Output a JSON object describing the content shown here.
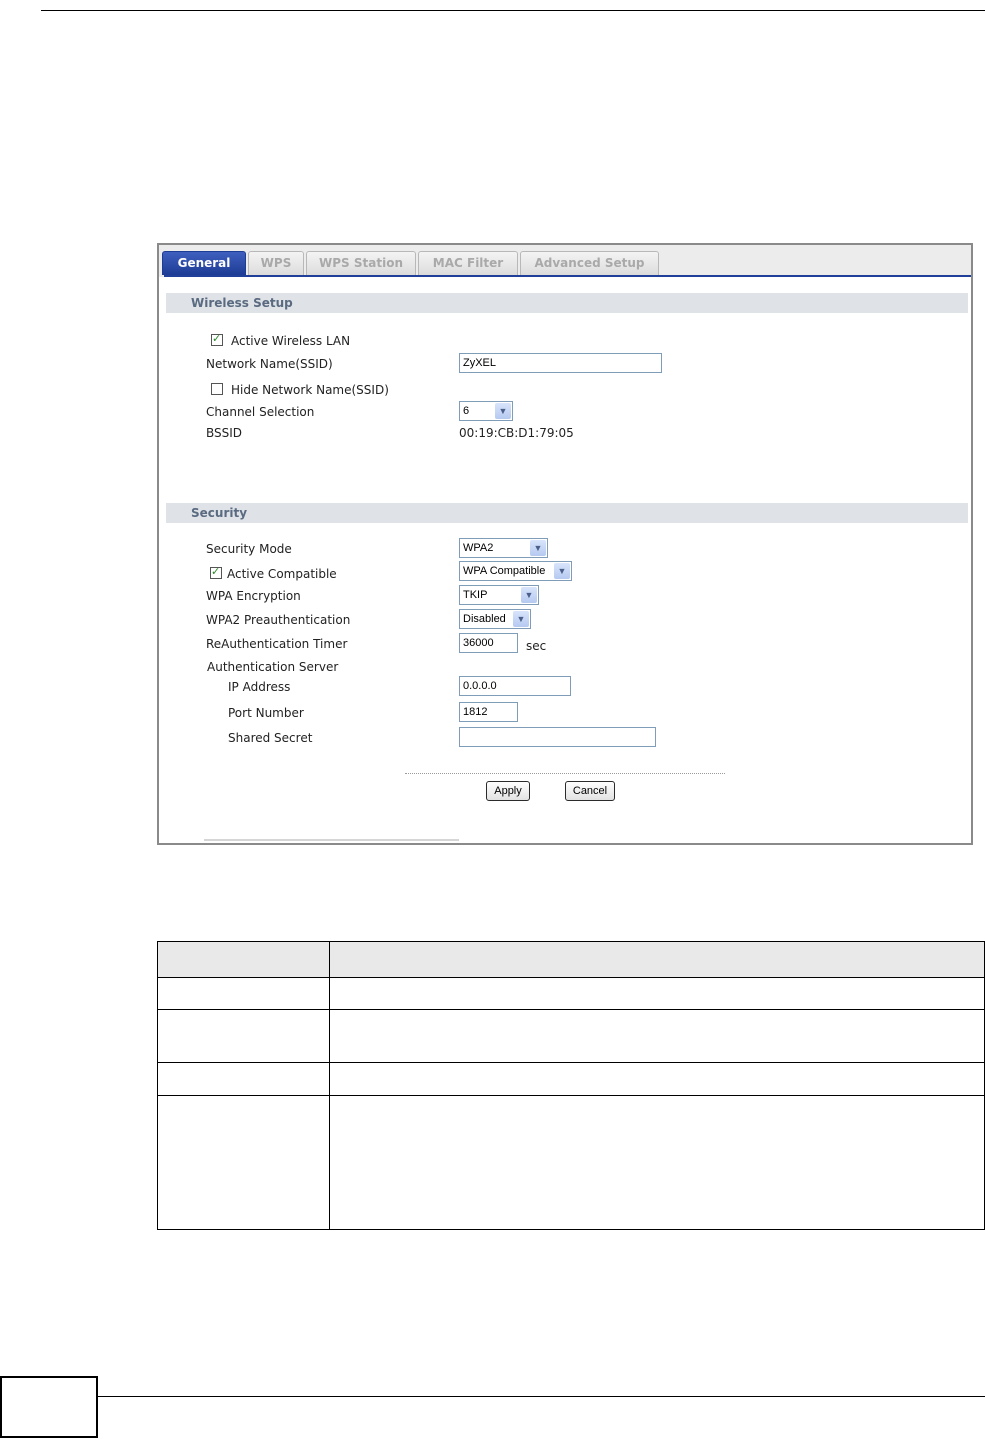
{
  "tabs": [
    {
      "label": "General",
      "active": true
    },
    {
      "label": "WPS",
      "active": false
    },
    {
      "label": "WPS Station",
      "active": false
    },
    {
      "label": "MAC Filter",
      "active": false
    },
    {
      "label": "Advanced Setup",
      "active": false
    }
  ],
  "wireless_setup": {
    "header": "Wireless Setup",
    "active_wlan_label": "Active Wireless LAN",
    "active_wlan_checked": true,
    "ssid_label": "Network Name(SSID)",
    "ssid_value": "ZyXEL",
    "hide_ssid_label": "Hide Network Name(SSID)",
    "hide_ssid_checked": false,
    "channel_label": "Channel Selection",
    "channel_value": "6",
    "bssid_label": "BSSID",
    "bssid_value": "00:19:CB:D1:79:05"
  },
  "security": {
    "header": "Security",
    "mode_label": "Security Mode",
    "mode_value": "WPA2",
    "active_compatible_label": "Active Compatible",
    "active_compatible_checked": true,
    "compatible_value": "WPA Compatible",
    "encryption_label": "WPA Encryption",
    "encryption_value": "TKIP",
    "preauth_label": "WPA2 Preauthentication",
    "preauth_value": "Disabled",
    "reauth_label": "ReAuthentication Timer",
    "reauth_value": "36000",
    "reauth_unit": "sec",
    "auth_server_label": "Authentication Server",
    "ip_label": "IP Address",
    "ip_value": "0.0.0.0",
    "port_label": "Port Number",
    "port_value": "1812",
    "secret_label": "Shared Secret",
    "secret_value": ""
  },
  "buttons": {
    "apply": "Apply",
    "cancel": "Cancel"
  },
  "icons": {
    "checkbox_checked": "check-icon",
    "dropdown_arrow": "chevron-down-icon"
  },
  "colors": {
    "active_tab": "#1d3c94",
    "section_header_bg": "#dfe3e8",
    "check_mark": "#2a8a2a"
  }
}
